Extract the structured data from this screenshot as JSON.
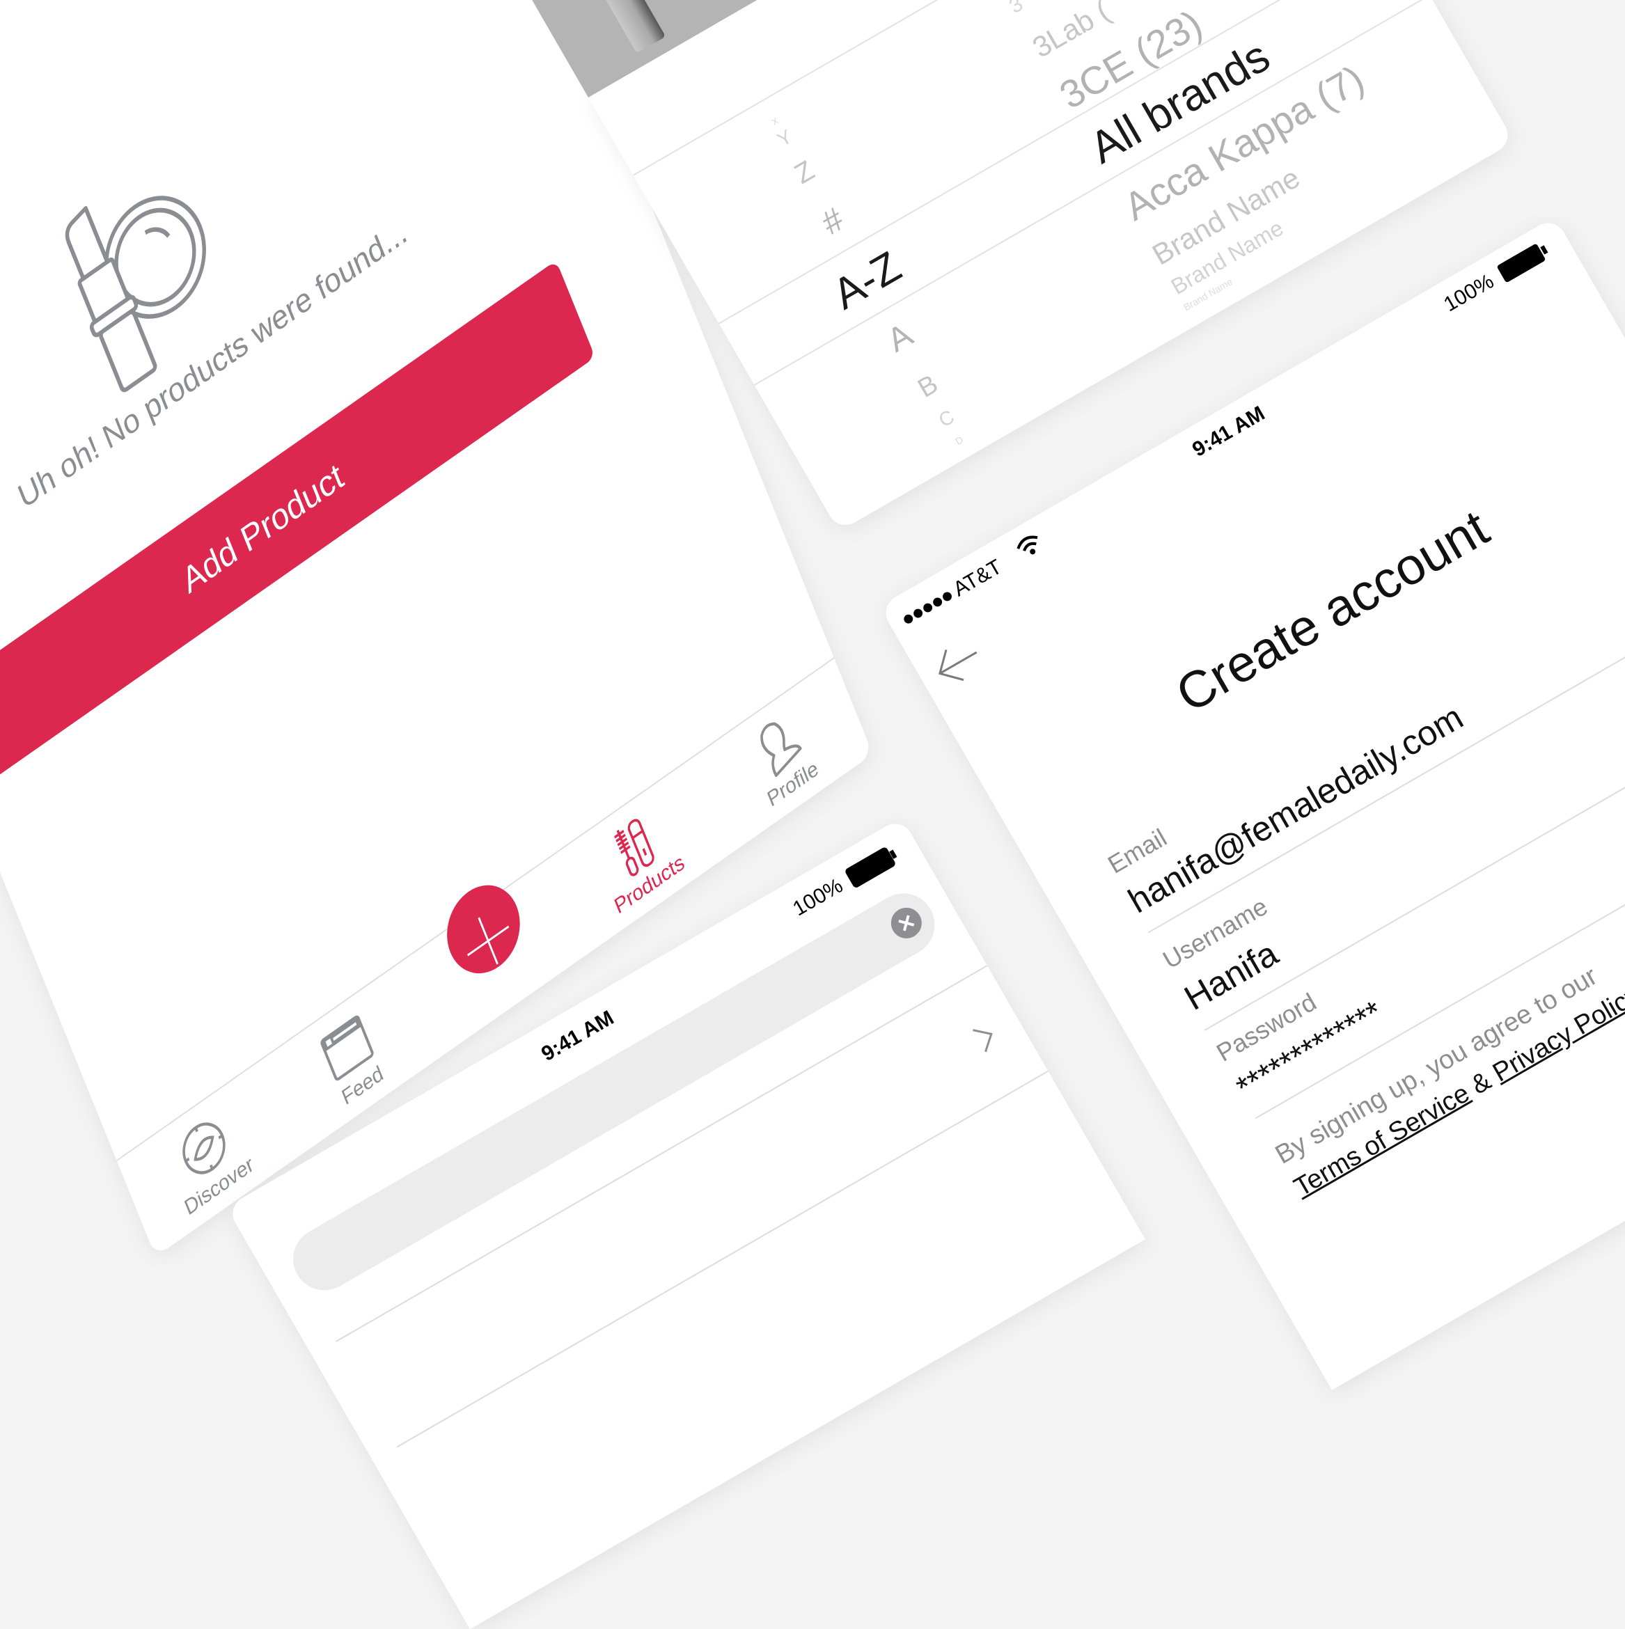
{
  "colors": {
    "accent": "#dc274f",
    "icon_gray": "#8a8d91",
    "background": "#f4f3f4"
  },
  "products_screen": {
    "empty_message": "Uh oh! No products were found...",
    "add_button": "Add Product",
    "tabs": [
      {
        "label": "Discover",
        "icon": "compass-icon"
      },
      {
        "label": "Feed",
        "icon": "feed-icon"
      },
      {
        "label": "",
        "icon": "plus-icon"
      },
      {
        "label": "Products",
        "icon": "products-icon",
        "active": true
      },
      {
        "label": "Profile",
        "icon": "profile-icon"
      }
    ]
  },
  "brand_picker": {
    "index_column": [
      "x",
      "Y",
      "Z",
      "#",
      "A-Z",
      "A",
      "B",
      "C",
      "D"
    ],
    "index_selected": "A-Z",
    "brand_column": [
      "3",
      "3Lab (",
      "3CE (23)",
      "All brands",
      "Acca Kappa (7)",
      "Brand Name",
      "Brand Name",
      "Brand Name"
    ],
    "brand_selected": "All brands"
  },
  "create_account": {
    "status": {
      "signal": "●●●●●",
      "carrier": "AT&T",
      "time": "9:41 AM",
      "battery": "100%"
    },
    "title": "Create account",
    "fields": [
      {
        "label": "Email",
        "value": "hanifa@femaledaily.com"
      },
      {
        "label": "Username",
        "value": "Hanifa"
      },
      {
        "label": "Password",
        "value": "*************"
      }
    ],
    "terms_text": "By signing up, you agree to our",
    "terms_link": "Terms of Service",
    "terms_and": " & ",
    "privacy_link": "Privacy Policy"
  },
  "search_screen": {
    "status": {
      "time": "9:41 AM",
      "battery": "100%"
    }
  }
}
